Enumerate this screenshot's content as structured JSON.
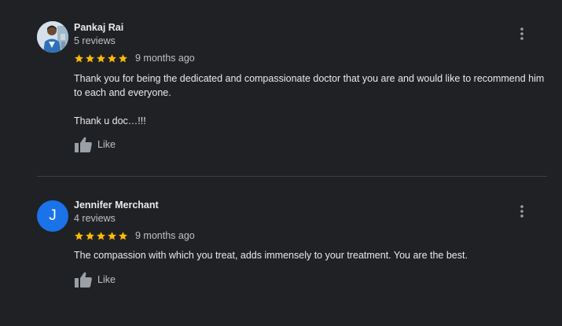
{
  "reviews": [
    {
      "name": "Pankaj Rai",
      "review_count": "5 reviews",
      "time": "9 months ago",
      "rating": 5,
      "paragraphs": [
        "Thank you for being the dedicated and compassionate doctor that you are and would like to recommend him to each and everyone.",
        "Thank u doc…!!!"
      ],
      "like_label": "Like",
      "avatar_type": "photo"
    },
    {
      "name": "Jennifer Merchant",
      "review_count": "4 reviews",
      "time": "9 months ago",
      "rating": 5,
      "paragraphs": [
        "The compassion  with which you treat, adds immensely to your treatment. You are the best."
      ],
      "like_label": "Like",
      "avatar_type": "letter",
      "avatar_letter": "J"
    }
  ],
  "icons": {
    "star": "star-icon",
    "like": "thumbs-up-icon",
    "more": "more-vert-icon"
  },
  "colors": {
    "background": "#202124",
    "star": "#fbbc04",
    "avatar_letter_bg": "#1a73e8",
    "secondary_text": "#bdc1c6",
    "divider": "#3c4043"
  }
}
